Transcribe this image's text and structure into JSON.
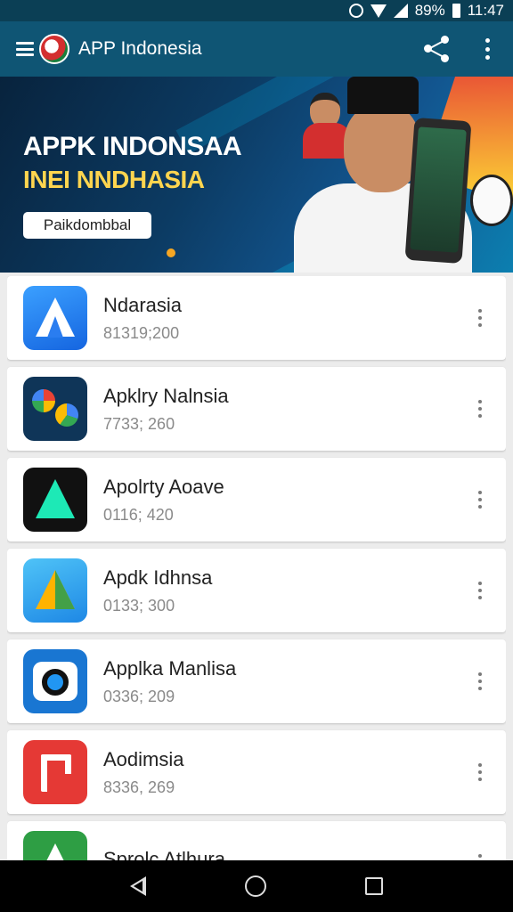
{
  "status_bar": {
    "battery_text": "89%",
    "time": "11:47"
  },
  "app_bar": {
    "title": "APP Indonesia"
  },
  "banner": {
    "headline": "APPK INDONSAA",
    "subheadline": "INEI NNDHASIA",
    "button_label": "Paikdombbal"
  },
  "apps": [
    {
      "name": "Ndarasia",
      "sub": "81319;200",
      "icon": "app-a-icon"
    },
    {
      "name": "Apklry Nalnsia",
      "sub": "7733; 260",
      "icon": "colorful-swirl-icon"
    },
    {
      "name": "Apolrty Aoave",
      "sub": "0116; 420",
      "icon": "app-a-dark-icon"
    },
    {
      "name": "Apdk Idhnsa",
      "sub": "0133; 300",
      "icon": "app-a-tricolor-icon"
    },
    {
      "name": "Applka Manlisa",
      "sub": "0336; 209",
      "icon": "camera-icon"
    },
    {
      "name": "Aodimsia",
      "sub": "8336, 269",
      "icon": "p-letter-icon"
    },
    {
      "name": "Sprolc Atlhura",
      "sub": "",
      "icon": "app-a-green-icon"
    }
  ],
  "colors": {
    "app_bar": "#0f5574",
    "status_bar": "#0b3f55",
    "list_background": "#ececec",
    "nav_bar": "#000000"
  }
}
